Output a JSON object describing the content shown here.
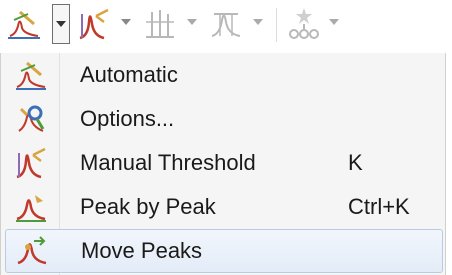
{
  "toolbar": {
    "buttons": [
      {
        "icon": "automatic-peak-icon"
      },
      {
        "icon": "manual-threshold-icon"
      },
      {
        "icon": "baseline-icon"
      },
      {
        "icon": "peak-shape-icon"
      },
      {
        "icon": "cluster-icon"
      }
    ]
  },
  "menu": {
    "items": [
      {
        "label": "Automatic",
        "shortcut": "",
        "icon": "automatic-peak-icon"
      },
      {
        "label": "Options...",
        "shortcut": "",
        "icon": "options-icon"
      },
      {
        "label": "Manual Threshold",
        "shortcut": "K",
        "icon": "manual-threshold-icon"
      },
      {
        "label": "Peak by Peak",
        "shortcut": "Ctrl+K",
        "icon": "peak-by-peak-icon"
      },
      {
        "label": "Move Peaks",
        "shortcut": "",
        "icon": "move-peaks-icon"
      }
    ],
    "hovered": "Move Peaks"
  },
  "colors": {
    "icon_red": "#c0392b",
    "icon_gold": "#d9a441",
    "icon_green": "#4f9a3c",
    "icon_disabled": "#b8b8b8",
    "hover_border": "#b8cce4"
  }
}
